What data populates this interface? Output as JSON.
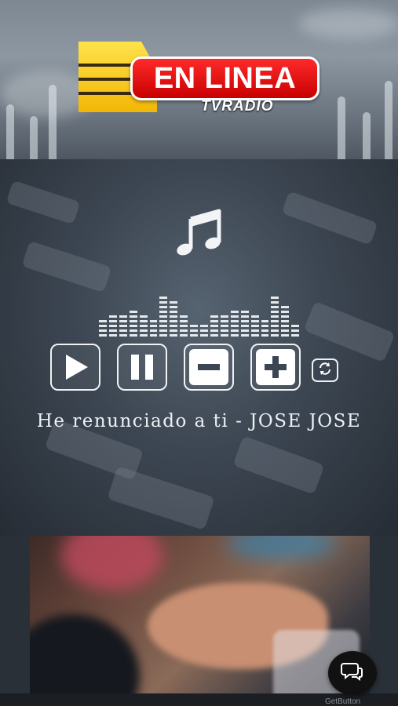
{
  "logo": {
    "title": "EN LINEA",
    "subtitle": "TVRADIO",
    "colors": {
      "red": "#e11515",
      "yellow": "#f7c815"
    }
  },
  "player": {
    "music_icon": "music-note-icon",
    "equalizer_levels": [
      0.45,
      0.6,
      0.55,
      0.7,
      0.5,
      0.4,
      0.95,
      0.85,
      0.55,
      0.35,
      0.3,
      0.6,
      0.5,
      0.7,
      0.65,
      0.5,
      0.4,
      0.95,
      0.75,
      0.3
    ],
    "controls": [
      {
        "name": "play-button",
        "icon": "play-icon"
      },
      {
        "name": "pause-button",
        "icon": "pause-icon"
      },
      {
        "name": "volume-down-button",
        "icon": "minus-icon"
      },
      {
        "name": "volume-up-button",
        "icon": "plus-icon"
      }
    ],
    "refresh_icon": "refresh-icon",
    "now_playing": "He renunciado a ti - JOSE JOSE"
  },
  "chat_button": {
    "icon": "chat-bubbles-icon",
    "label": "GetButton"
  }
}
